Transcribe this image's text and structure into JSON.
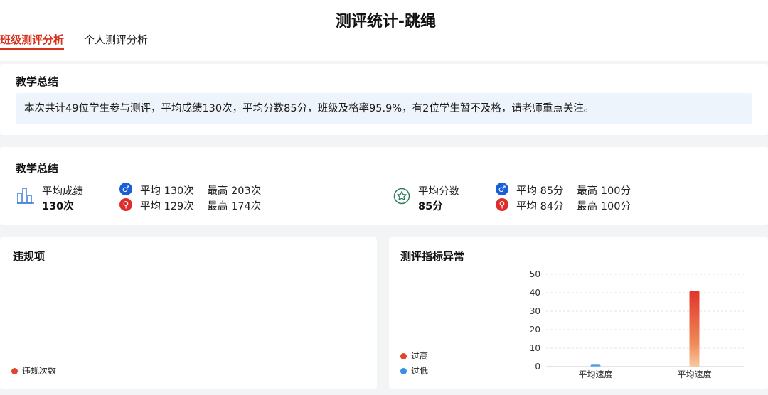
{
  "header": {
    "title": "测评统计-跳绳",
    "tabs": [
      {
        "label": "班级测评分析",
        "active": true
      },
      {
        "label": "个人测评分析",
        "active": false
      }
    ]
  },
  "summary": {
    "title": "教学总结",
    "text": "本次共计49位学生参与测评，平均成绩130次，平均分数85分，班级及格率95.9%，有2位学生暂不及格，请老师重点关注。"
  },
  "stats": {
    "title": "教学总结",
    "score": {
      "icon": "bar-chart-icon",
      "label": "平均成绩",
      "value": "130次",
      "male": {
        "avg": "平均 130次",
        "max": "最高 203次"
      },
      "female": {
        "avg": "平均 129次",
        "max": "最高 174次"
      }
    },
    "points": {
      "icon": "star-badge-icon",
      "label": "平均分数",
      "value": "85分",
      "male": {
        "avg": "平均 85分",
        "max": "最高 100分"
      },
      "female": {
        "avg": "平均 84分",
        "max": "最高 100分"
      }
    },
    "male_symbol": "♂",
    "female_symbol": "♀"
  },
  "violations": {
    "title": "违规项",
    "legend": "违规次数",
    "legend_color": "#e0462a"
  },
  "anomaly": {
    "title": "测评指标异常",
    "legend": [
      {
        "label": "过高",
        "color": "#e0462a"
      },
      {
        "label": "过低",
        "color": "#3a8ee6"
      }
    ]
  },
  "chart_data": {
    "type": "bar",
    "categories": [
      "平均速度",
      "平均速度"
    ],
    "series": [
      {
        "name": "过低",
        "values": [
          1,
          0
        ],
        "color": "#3a8ee6"
      },
      {
        "name": "过高",
        "values": [
          0,
          41
        ],
        "color": "#e0462a"
      }
    ],
    "yticks": [
      "0",
      "10",
      "20",
      "30",
      "40",
      "50"
    ],
    "ylim": [
      0,
      50
    ],
    "grid": true
  }
}
